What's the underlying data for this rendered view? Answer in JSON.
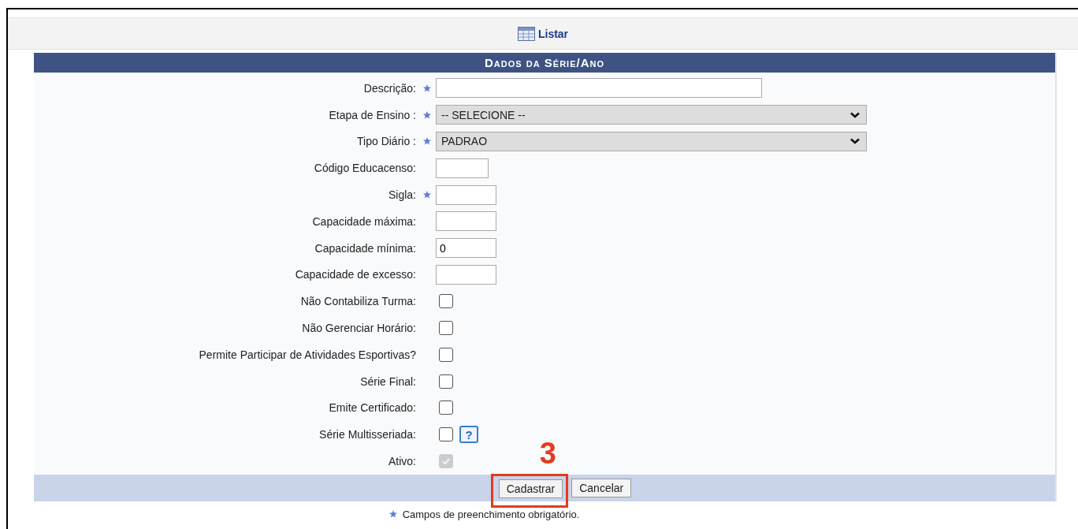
{
  "top_bar": {
    "link": "Listar"
  },
  "panel": {
    "title": "Dados da Série/Ano",
    "rows": [
      {
        "kind": "text",
        "label": "Descrição:",
        "required": true,
        "value": ""
      },
      {
        "kind": "select",
        "label": "Etapa de Ensino :",
        "required": true,
        "value": "-- SELECIONE --"
      },
      {
        "kind": "select",
        "label": "Tipo Diário :",
        "required": true,
        "value": "PADRAO"
      },
      {
        "kind": "text",
        "label": "Código Educacenso:",
        "required": false,
        "value": ""
      },
      {
        "kind": "text",
        "label": "Sigla:",
        "required": true,
        "value": ""
      },
      {
        "kind": "text",
        "label": "Capacidade máxima:",
        "required": false,
        "value": ""
      },
      {
        "kind": "text",
        "label": "Capacidade mínima:",
        "required": false,
        "value": "0"
      },
      {
        "kind": "text",
        "label": "Capacidade de excesso:",
        "required": false,
        "value": ""
      },
      {
        "kind": "checkbox",
        "label": "Não Contabiliza Turma:",
        "required": false,
        "checked": false,
        "disabled": false
      },
      {
        "kind": "checkbox",
        "label": "Não Gerenciar Horário:",
        "required": false,
        "checked": false,
        "disabled": false
      },
      {
        "kind": "checkbox",
        "label": "Permite Participar de Atividades Esportivas?",
        "required": false,
        "checked": false,
        "disabled": false
      },
      {
        "kind": "checkbox",
        "label": "Série Final:",
        "required": false,
        "checked": false,
        "disabled": false
      },
      {
        "kind": "checkbox",
        "label": "Emite Certificado:",
        "required": false,
        "checked": false,
        "disabled": false
      },
      {
        "kind": "checkbox",
        "label": "Série Multisseriada:",
        "required": false,
        "checked": false,
        "disabled": false,
        "help": "?"
      },
      {
        "kind": "checkbox",
        "label": "Ativo:",
        "required": false,
        "checked": true,
        "disabled": true
      }
    ],
    "buttons": [
      {
        "label": "Cadastrar",
        "highlighted": true
      },
      {
        "label": "Cancelar",
        "highlighted": false
      }
    ]
  },
  "annotation": {
    "step": "3"
  },
  "note": "Campos de preenchimento obrigatório."
}
